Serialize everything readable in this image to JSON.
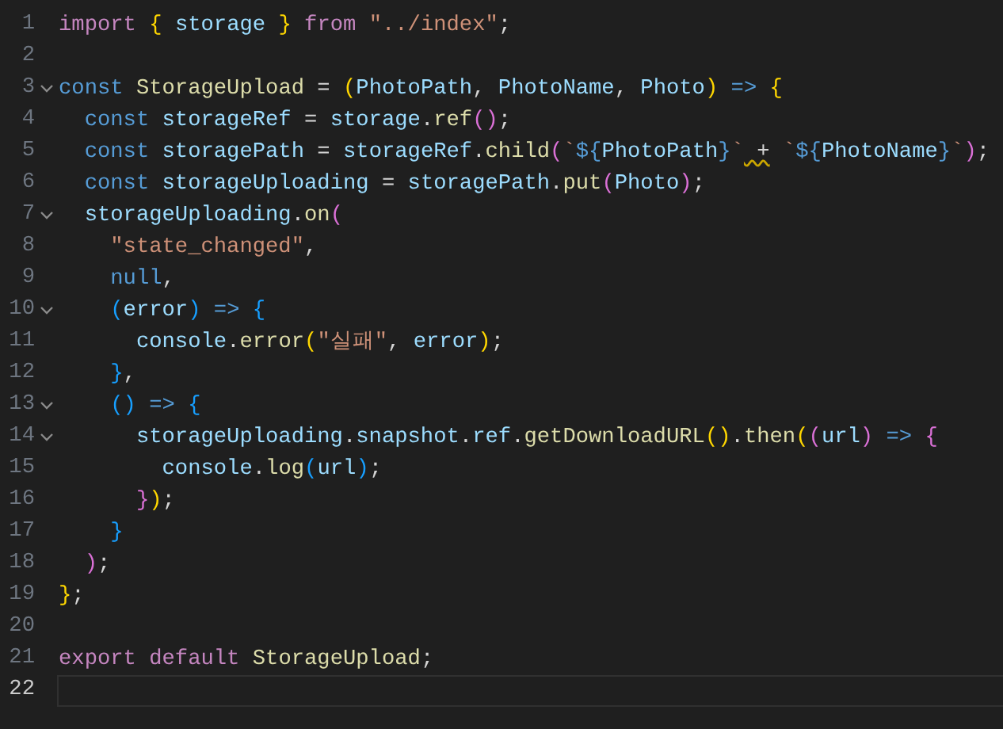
{
  "editor": {
    "lines": [
      {
        "number": "1",
        "fold": false,
        "current": false,
        "tokens": [
          {
            "kind": "keyword",
            "t": "import"
          },
          {
            "kind": "bracket1",
            "t": " {"
          },
          {
            "kind": "variable",
            "t": " storage"
          },
          {
            "kind": "bracket1",
            "t": " }"
          },
          {
            "kind": "keyword",
            "t": " from"
          },
          {
            "kind": "string",
            "t": " \"../index\""
          },
          {
            "kind": "punct",
            "t": ";"
          }
        ]
      },
      {
        "number": "2",
        "fold": false,
        "current": false
      },
      {
        "number": "3",
        "fold": true,
        "current": false,
        "tokens": [
          {
            "kind": "storage",
            "t": "const"
          },
          {
            "kind": "function",
            "t": " StorageUpload"
          },
          {
            "kind": "punct",
            "t": " ="
          },
          {
            "kind": "bracket1",
            "t": " ("
          },
          {
            "kind": "variable",
            "t": "PhotoPath"
          },
          {
            "kind": "punct",
            "t": ","
          },
          {
            "kind": "variable",
            "t": " PhotoName"
          },
          {
            "kind": "punct",
            "t": ","
          },
          {
            "kind": "variable",
            "t": " Photo"
          },
          {
            "kind": "bracket1",
            "t": ")"
          },
          {
            "kind": "storage",
            "t": " =>"
          },
          {
            "kind": "bracket1",
            "t": " {"
          }
        ]
      },
      {
        "number": "4",
        "fold": false,
        "current": false,
        "tokens": [
          {
            "kind": "storage",
            "t": "  const"
          },
          {
            "kind": "variable",
            "t": " storageRef"
          },
          {
            "kind": "punct",
            "t": " ="
          },
          {
            "kind": "variable",
            "t": " storage"
          },
          {
            "kind": "punct",
            "t": "."
          },
          {
            "kind": "function",
            "t": "ref"
          },
          {
            "kind": "bracket2",
            "t": "()"
          },
          {
            "kind": "punct",
            "t": ";"
          }
        ]
      },
      {
        "number": "5",
        "fold": false,
        "current": false,
        "tokens": [
          {
            "kind": "storage",
            "t": "  const"
          },
          {
            "kind": "variable",
            "t": " storagePath"
          },
          {
            "kind": "punct",
            "t": " ="
          },
          {
            "kind": "variable",
            "t": " storageRef"
          },
          {
            "kind": "punct",
            "t": "."
          },
          {
            "kind": "function",
            "t": "child"
          },
          {
            "kind": "bracket2",
            "t": "("
          },
          {
            "kind": "string",
            "t": "`"
          },
          {
            "kind": "storage",
            "t": "${"
          },
          {
            "kind": "variable",
            "t": "PhotoPath"
          },
          {
            "kind": "storage",
            "t": "}"
          },
          {
            "kind": "string",
            "t": "`"
          },
          {
            "kind": "warning",
            "t": " +"
          },
          {
            "kind": "string",
            "t": " `"
          },
          {
            "kind": "storage",
            "t": "${"
          },
          {
            "kind": "variable",
            "t": "PhotoName"
          },
          {
            "kind": "storage",
            "t": "}"
          },
          {
            "kind": "string",
            "t": "`"
          },
          {
            "kind": "bracket2",
            "t": ")"
          },
          {
            "kind": "punct",
            "t": ";"
          }
        ]
      },
      {
        "number": "6",
        "fold": false,
        "current": false,
        "tokens": [
          {
            "kind": "storage",
            "t": "  const"
          },
          {
            "kind": "variable",
            "t": " storageUploading"
          },
          {
            "kind": "punct",
            "t": " ="
          },
          {
            "kind": "variable",
            "t": " storagePath"
          },
          {
            "kind": "punct",
            "t": "."
          },
          {
            "kind": "function",
            "t": "put"
          },
          {
            "kind": "bracket2",
            "t": "("
          },
          {
            "kind": "variable",
            "t": "Photo"
          },
          {
            "kind": "bracket2",
            "t": ")"
          },
          {
            "kind": "punct",
            "t": ";"
          }
        ]
      },
      {
        "number": "7",
        "fold": true,
        "current": false,
        "tokens": [
          {
            "kind": "variable",
            "t": "  storageUploading"
          },
          {
            "kind": "punct",
            "t": "."
          },
          {
            "kind": "function",
            "t": "on"
          },
          {
            "kind": "bracket2",
            "t": "("
          }
        ]
      },
      {
        "number": "8",
        "fold": false,
        "current": false,
        "tokens": [
          {
            "kind": "string",
            "t": "    \"state_changed\""
          },
          {
            "kind": "punct",
            "t": ","
          }
        ]
      },
      {
        "number": "9",
        "fold": false,
        "current": false,
        "tokens": [
          {
            "kind": "storage",
            "t": "    null"
          },
          {
            "kind": "punct",
            "t": ","
          }
        ]
      },
      {
        "number": "10",
        "fold": true,
        "current": false,
        "tokens": [
          {
            "kind": "bracket3",
            "t": "    ("
          },
          {
            "kind": "variable",
            "t": "error"
          },
          {
            "kind": "bracket3",
            "t": ")"
          },
          {
            "kind": "storage",
            "t": " =>"
          },
          {
            "kind": "bracket3",
            "t": " {"
          }
        ]
      },
      {
        "number": "11",
        "fold": false,
        "current": false,
        "tokens": [
          {
            "kind": "variable",
            "t": "      console"
          },
          {
            "kind": "punct",
            "t": "."
          },
          {
            "kind": "function",
            "t": "error"
          },
          {
            "kind": "bracket1",
            "t": "("
          },
          {
            "kind": "string",
            "t": "\"실패\""
          },
          {
            "kind": "punct",
            "t": ","
          },
          {
            "kind": "variable",
            "t": " error"
          },
          {
            "kind": "bracket1",
            "t": ")"
          },
          {
            "kind": "punct",
            "t": ";"
          }
        ]
      },
      {
        "number": "12",
        "fold": false,
        "current": false,
        "tokens": [
          {
            "kind": "bracket3",
            "t": "    }"
          },
          {
            "kind": "punct",
            "t": ","
          }
        ]
      },
      {
        "number": "13",
        "fold": true,
        "current": false,
        "tokens": [
          {
            "kind": "bracket3",
            "t": "    ()"
          },
          {
            "kind": "storage",
            "t": " =>"
          },
          {
            "kind": "bracket3",
            "t": " {"
          }
        ]
      },
      {
        "number": "14",
        "fold": true,
        "current": false,
        "tokens": [
          {
            "kind": "variable",
            "t": "      storageUploading"
          },
          {
            "kind": "punct",
            "t": "."
          },
          {
            "kind": "variable",
            "t": "snapshot"
          },
          {
            "kind": "punct",
            "t": "."
          },
          {
            "kind": "variable",
            "t": "ref"
          },
          {
            "kind": "punct",
            "t": "."
          },
          {
            "kind": "function",
            "t": "getDownloadURL"
          },
          {
            "kind": "bracket1",
            "t": "()"
          },
          {
            "kind": "punct",
            "t": "."
          },
          {
            "kind": "function",
            "t": "then"
          },
          {
            "kind": "bracket1",
            "t": "("
          },
          {
            "kind": "bracket2",
            "t": "("
          },
          {
            "kind": "variable",
            "t": "url"
          },
          {
            "kind": "bracket2",
            "t": ")"
          },
          {
            "kind": "storage",
            "t": " =>"
          },
          {
            "kind": "bracket2",
            "t": " {"
          }
        ]
      },
      {
        "number": "15",
        "fold": false,
        "current": false,
        "tokens": [
          {
            "kind": "variable",
            "t": "        console"
          },
          {
            "kind": "punct",
            "t": "."
          },
          {
            "kind": "function",
            "t": "log"
          },
          {
            "kind": "bracket3",
            "t": "("
          },
          {
            "kind": "variable",
            "t": "url"
          },
          {
            "kind": "bracket3",
            "t": ")"
          },
          {
            "kind": "punct",
            "t": ";"
          }
        ]
      },
      {
        "number": "16",
        "fold": false,
        "current": false,
        "tokens": [
          {
            "kind": "bracket2",
            "t": "      }"
          },
          {
            "kind": "bracket1",
            "t": ")"
          },
          {
            "kind": "punct",
            "t": ";"
          }
        ]
      },
      {
        "number": "17",
        "fold": false,
        "current": false,
        "tokens": [
          {
            "kind": "bracket3",
            "t": "    }"
          }
        ]
      },
      {
        "number": "18",
        "fold": false,
        "current": false,
        "tokens": [
          {
            "kind": "bracket2",
            "t": "  )"
          },
          {
            "kind": "punct",
            "t": ";"
          }
        ]
      },
      {
        "number": "19",
        "fold": false,
        "current": false,
        "tokens": [
          {
            "kind": "bracket1",
            "t": "}"
          },
          {
            "kind": "punct",
            "t": ";"
          }
        ]
      },
      {
        "number": "20",
        "fold": false,
        "current": false
      },
      {
        "number": "21",
        "fold": false,
        "current": false,
        "tokens": [
          {
            "kind": "keyword",
            "t": "export"
          },
          {
            "kind": "keyword",
            "t": " default"
          },
          {
            "kind": "function",
            "t": " StorageUpload"
          },
          {
            "kind": "punct",
            "t": ";"
          }
        ]
      },
      {
        "number": "22",
        "fold": false,
        "current": true
      }
    ]
  }
}
